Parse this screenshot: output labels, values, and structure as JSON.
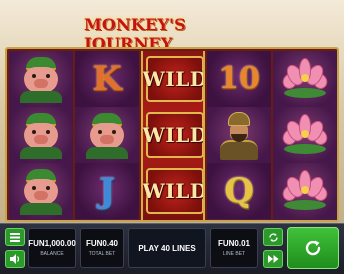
{
  "game": {
    "title": "MONKEY'S JOURNEY"
  },
  "reels": [
    [
      "pig",
      "pig",
      "pig"
    ],
    [
      "K",
      "pig",
      "J"
    ],
    [
      "WILD",
      "WILD",
      "WILD"
    ],
    [
      "10",
      "warrior",
      "Q"
    ],
    [
      "lotus",
      "lotus",
      "lotus"
    ]
  ],
  "controls": {
    "balance_value": "FUN1,000.00",
    "balance_label": "BALANCE",
    "total_bet_value": "FUN0.40",
    "total_bet_label": "TOTAL BET",
    "lines_label": "PLAY 40 LINES",
    "line_bet_value": "FUN0.01",
    "line_bet_label": "LINE BET"
  },
  "icons": {
    "menu": "menu-icon",
    "sound": "speaker-icon",
    "autoplay": "autoplay-icon",
    "fast": "fast-forward-icon",
    "spin": "spin-icon"
  },
  "colors": {
    "spin_green": "#2c9a2b",
    "title_red": "#c4121d",
    "reel_bg": "#46174a"
  }
}
